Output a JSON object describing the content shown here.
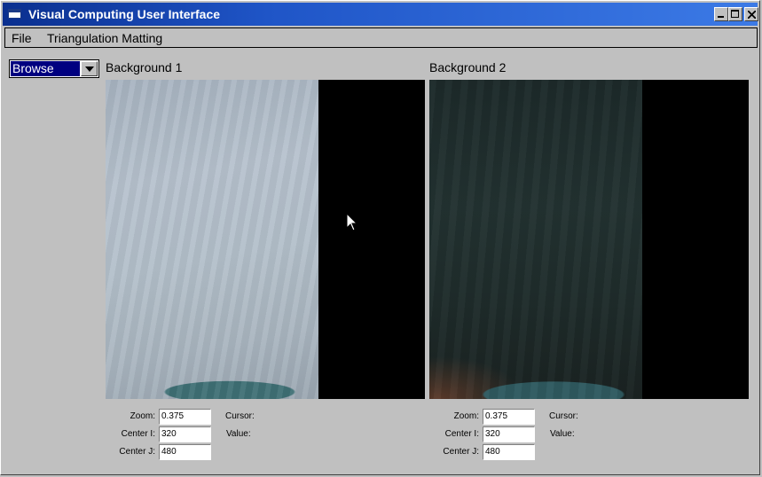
{
  "window": {
    "title": "Visual Computing User Interface"
  },
  "menu": {
    "items": [
      "File",
      "Triangulation Matting"
    ]
  },
  "mode_select": {
    "value": "Browse"
  },
  "panels": [
    {
      "title": "Background 1",
      "zoom_label": "Zoom:",
      "zoom_value": "0.375",
      "center_i_label": "Center I:",
      "center_i_value": "320",
      "center_j_label": "Center J:",
      "center_j_value": "480",
      "cursor_label": "Cursor:",
      "value_label": "Value:"
    },
    {
      "title": "Background 2",
      "zoom_label": "Zoom:",
      "zoom_value": "0.375",
      "center_i_label": "Center I:",
      "center_i_value": "320",
      "center_j_label": "Center J:",
      "center_j_value": "480",
      "cursor_label": "Cursor:",
      "value_label": "Value:"
    }
  ],
  "icons": [
    "app-icon",
    "minimize-icon",
    "maximize-icon",
    "close-icon",
    "dropdown-arrow-icon",
    "mouse-pointer-icon"
  ]
}
